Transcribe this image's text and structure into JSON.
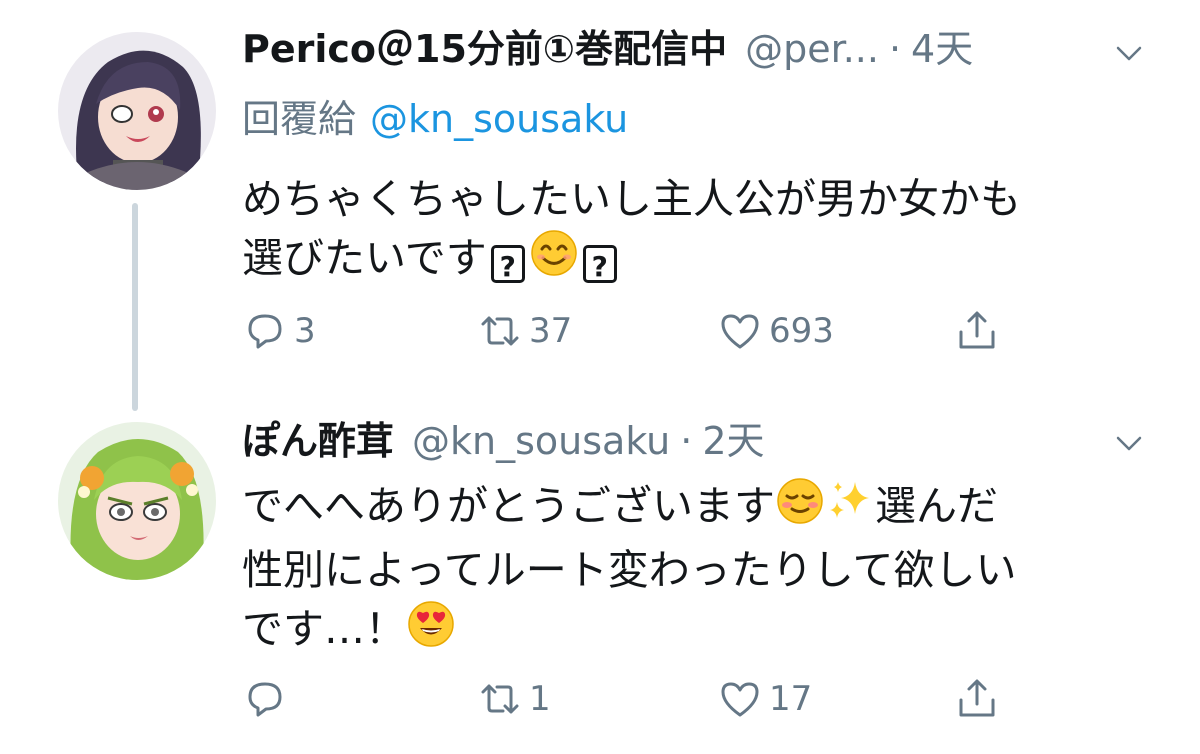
{
  "colors": {
    "secondary_text": "#657786",
    "link": "#1b95e0",
    "thread_line": "#ccd6dd",
    "primary_text": "#14171a"
  },
  "tweets": [
    {
      "display_name": "Perico＠15分前①巻配信中",
      "handle": "@per...",
      "separator": "·",
      "time": "4天",
      "reply_prefix": "回覆給",
      "reply_mention": "@kn_sousaku",
      "text_line1": "めちゃくちゃしたいし主人公が男か女かも",
      "text_line2": "選びたいです",
      "tofu_glyph": "?",
      "emojis": [
        "smiling-face-icon"
      ],
      "actions": {
        "reply_count": "3",
        "retweet_count": "37",
        "like_count": "693"
      },
      "avatar": "anime-girl-dark-hair-eyepatch"
    },
    {
      "display_name": "ぽん酢茸",
      "handle": "@kn_sousaku",
      "separator": "·",
      "time": "2天",
      "text_line1_a": "でへへありがとうございます",
      "text_line1_b": "選んだ",
      "text_line2": "性別によってルート変わったりして欲しい",
      "text_line3": "です…！",
      "emojis": [
        "relieved-blush-face-icon",
        "sparkles-icon",
        "heart-eyes-face-icon"
      ],
      "actions": {
        "reply_count": "",
        "retweet_count": "1",
        "like_count": "17"
      },
      "avatar": "anime-girl-green-hair-flowers"
    }
  ]
}
